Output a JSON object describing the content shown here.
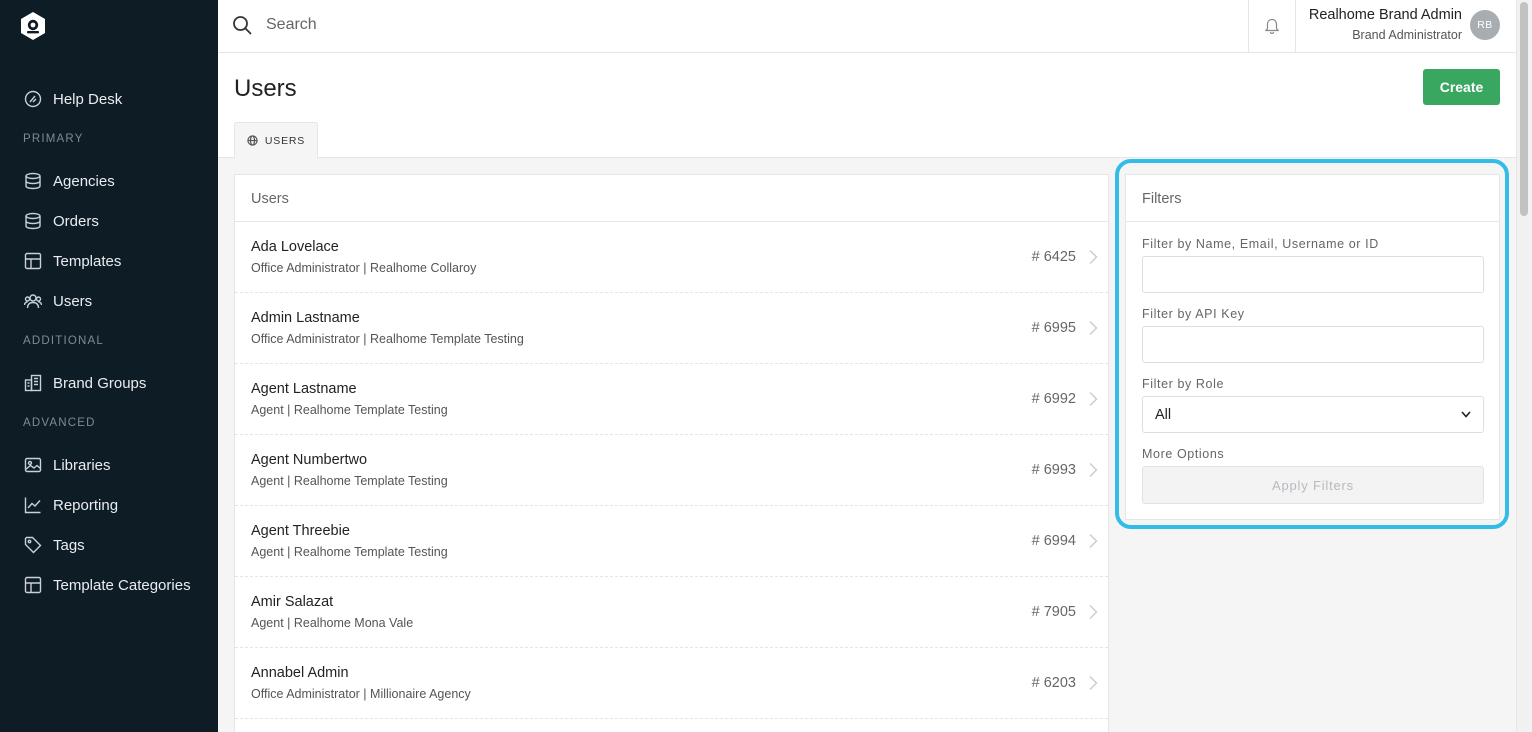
{
  "brand": {
    "logo_icon": "brand-logo-icon"
  },
  "sidebar": {
    "help_desk": "Help Desk",
    "sections": {
      "primary": "PRIMARY",
      "additional": "ADDITIONAL",
      "advanced": "ADVANCED"
    },
    "items": [
      {
        "label": "Agencies",
        "icon": "agencies-icon"
      },
      {
        "label": "Orders",
        "icon": "orders-icon"
      },
      {
        "label": "Templates",
        "icon": "templates-icon"
      },
      {
        "label": "Users",
        "icon": "users-icon"
      },
      {
        "label": "Brand Groups",
        "icon": "brand-groups-icon"
      },
      {
        "label": "Libraries",
        "icon": "libraries-icon"
      },
      {
        "label": "Reporting",
        "icon": "reporting-icon"
      },
      {
        "label": "Tags",
        "icon": "tags-icon"
      },
      {
        "label": "Template Categories",
        "icon": "template-categories-icon"
      }
    ]
  },
  "topbar": {
    "search_placeholder": "Search",
    "user_name": "Realhome Brand Admin",
    "user_role": "Brand Administrator",
    "avatar_initials": "RB"
  },
  "page": {
    "title": "Users",
    "create_label": "Create",
    "tab_label": "USERS"
  },
  "users_list": {
    "header": "Users",
    "rows": [
      {
        "name": "Ada Lovelace",
        "sub": "Office Administrator | Realhome Collaroy",
        "id": "# 6425"
      },
      {
        "name": "Admin Lastname",
        "sub": "Office Administrator | Realhome Template Testing",
        "id": "# 6995"
      },
      {
        "name": "Agent Lastname",
        "sub": "Agent | Realhome Template Testing",
        "id": "# 6992"
      },
      {
        "name": "Agent Numbertwo",
        "sub": "Agent | Realhome Template Testing",
        "id": "# 6993"
      },
      {
        "name": "Agent Threebie",
        "sub": "Agent | Realhome Template Testing",
        "id": "# 6994"
      },
      {
        "name": "Amir Salazat",
        "sub": "Agent | Realhome Mona Vale",
        "id": "# 7905"
      },
      {
        "name": "Annabel Admin",
        "sub": "Office Administrator | Millionaire Agency",
        "id": "# 6203"
      }
    ]
  },
  "filters": {
    "header": "Filters",
    "name_label": "Filter by Name, Email, Username or ID",
    "name_value": "",
    "api_label": "Filter by API Key",
    "api_value": "",
    "role_label": "Filter by Role",
    "role_value": "All",
    "more_options_label": "More Options",
    "apply_label": "Apply Filters"
  },
  "colors": {
    "sidebar_bg": "#0e1c26",
    "create_button": "#3aa760",
    "highlight": "#33bde6"
  }
}
